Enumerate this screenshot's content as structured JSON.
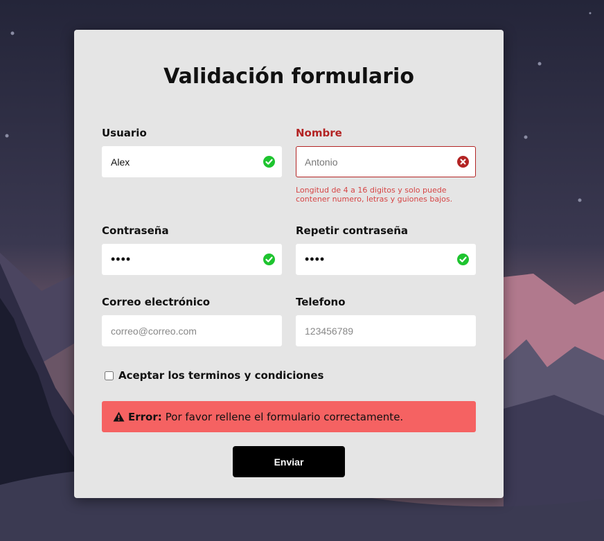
{
  "title": "Validación formulario",
  "fields": {
    "usuario": {
      "label": "Usuario",
      "value": "Alex",
      "status": "valid"
    },
    "nombre": {
      "label": "Nombre",
      "value": "Antonio",
      "status": "invalid",
      "error_message": "Longitud de 4 a 16 digitos y solo puede contener numero, letras y guiones bajos."
    },
    "password": {
      "label": "Contraseña",
      "value": "••••",
      "status": "valid"
    },
    "password2": {
      "label": "Repetir contraseña",
      "value": "••••",
      "status": "valid"
    },
    "correo": {
      "label": "Correo electrónico",
      "placeholder": "correo@correo.com",
      "value": ""
    },
    "telefono": {
      "label": "Telefono",
      "placeholder": "123456789",
      "value": ""
    }
  },
  "terms": {
    "label": "Aceptar los terminos y condiciones",
    "checked": false
  },
  "alert": {
    "prefix": "Error:",
    "message": "Por favor rellene el formulario correctamente."
  },
  "submit_label": "Enviar",
  "icons": {
    "valid": "check-circle-icon",
    "invalid": "x-circle-icon",
    "alert": "warning-triangle-icon"
  },
  "colors": {
    "valid": "#1ec42f",
    "invalid": "#b32424",
    "alert_bg": "#f56262",
    "button_bg": "#000000",
    "card_bg": "#e5e5e5"
  }
}
